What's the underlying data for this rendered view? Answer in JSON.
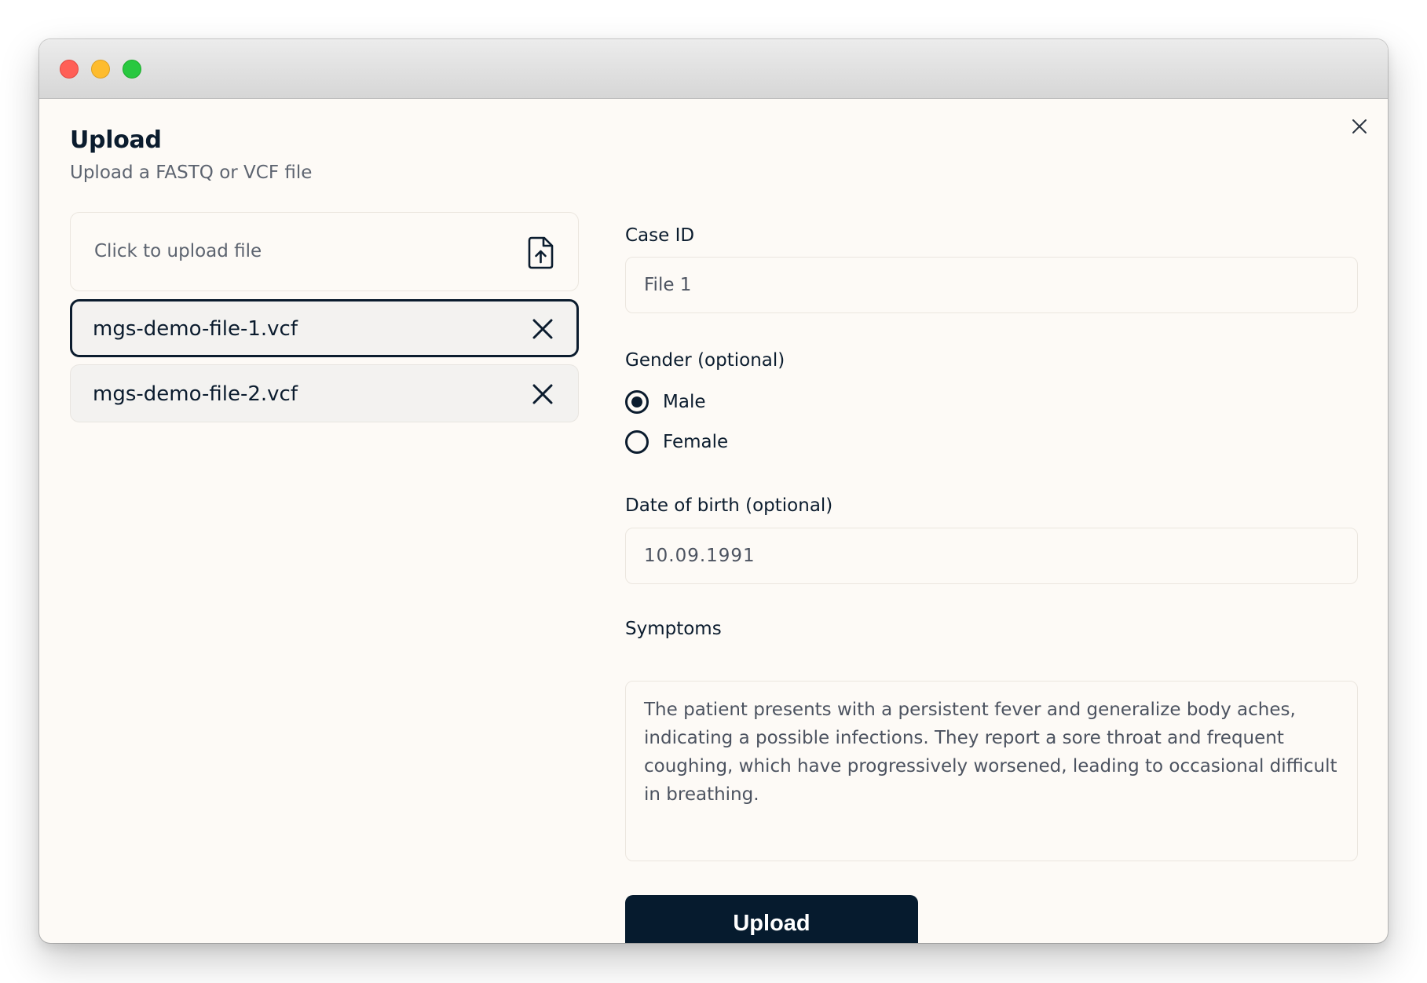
{
  "window": {
    "controls": [
      "close",
      "minimize",
      "zoom"
    ]
  },
  "dialog": {
    "title": "Upload",
    "subtitle": "Upload a FASTQ or VCF file",
    "close_icon": "close-icon"
  },
  "dropzone": {
    "label": "Click to upload file",
    "icon": "file-upload-icon"
  },
  "files": [
    {
      "name": "mgs-demo-file-1.vcf",
      "selected": true
    },
    {
      "name": "mgs-demo-file-2.vcf",
      "selected": false
    }
  ],
  "form": {
    "case_id": {
      "label": "Case ID",
      "value": "File 1"
    },
    "gender": {
      "label": "Gender (optional)",
      "options": [
        {
          "label": "Male",
          "checked": true
        },
        {
          "label": "Female",
          "checked": false
        }
      ]
    },
    "dob": {
      "label": "Date of birth (optional)",
      "value": "10.09.1991"
    },
    "symptoms": {
      "label": "Symptoms",
      "value": "The patient presents with a persistent fever and generalize body aches, indicating a possible infections. They report a sore throat and frequent coughing, which have progressively worsened, leading to occasional difficult in breathing."
    },
    "submit_label": "Upload"
  },
  "colors": {
    "primary": "#061b2e",
    "background": "#fdfaf6",
    "text": "#0b1c2e",
    "muted": "#5d6470"
  }
}
